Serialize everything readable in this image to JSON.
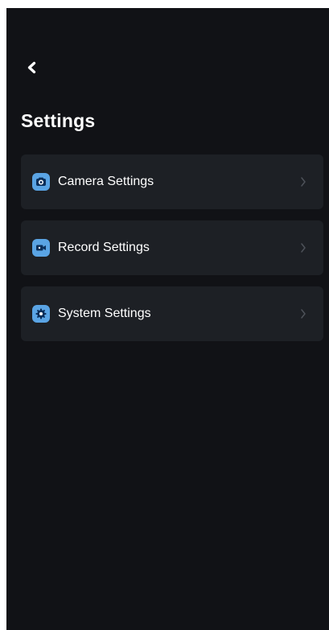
{
  "header": {
    "title": "Settings",
    "back_icon": "chevron-left-icon"
  },
  "colors": {
    "background": "#111216",
    "card": "#1d2025",
    "accent": "#5aa4e4",
    "text": "#ffffff",
    "chevron": "#4d5159"
  },
  "settings": {
    "items": [
      {
        "label": "Camera Settings",
        "icon": "camera-icon",
        "chevron_icon": "chevron-right-icon"
      },
      {
        "label": "Record Settings",
        "icon": "video-camera-icon",
        "chevron_icon": "chevron-right-icon"
      },
      {
        "label": "System Settings",
        "icon": "gear-icon",
        "chevron_icon": "chevron-right-icon"
      }
    ]
  }
}
